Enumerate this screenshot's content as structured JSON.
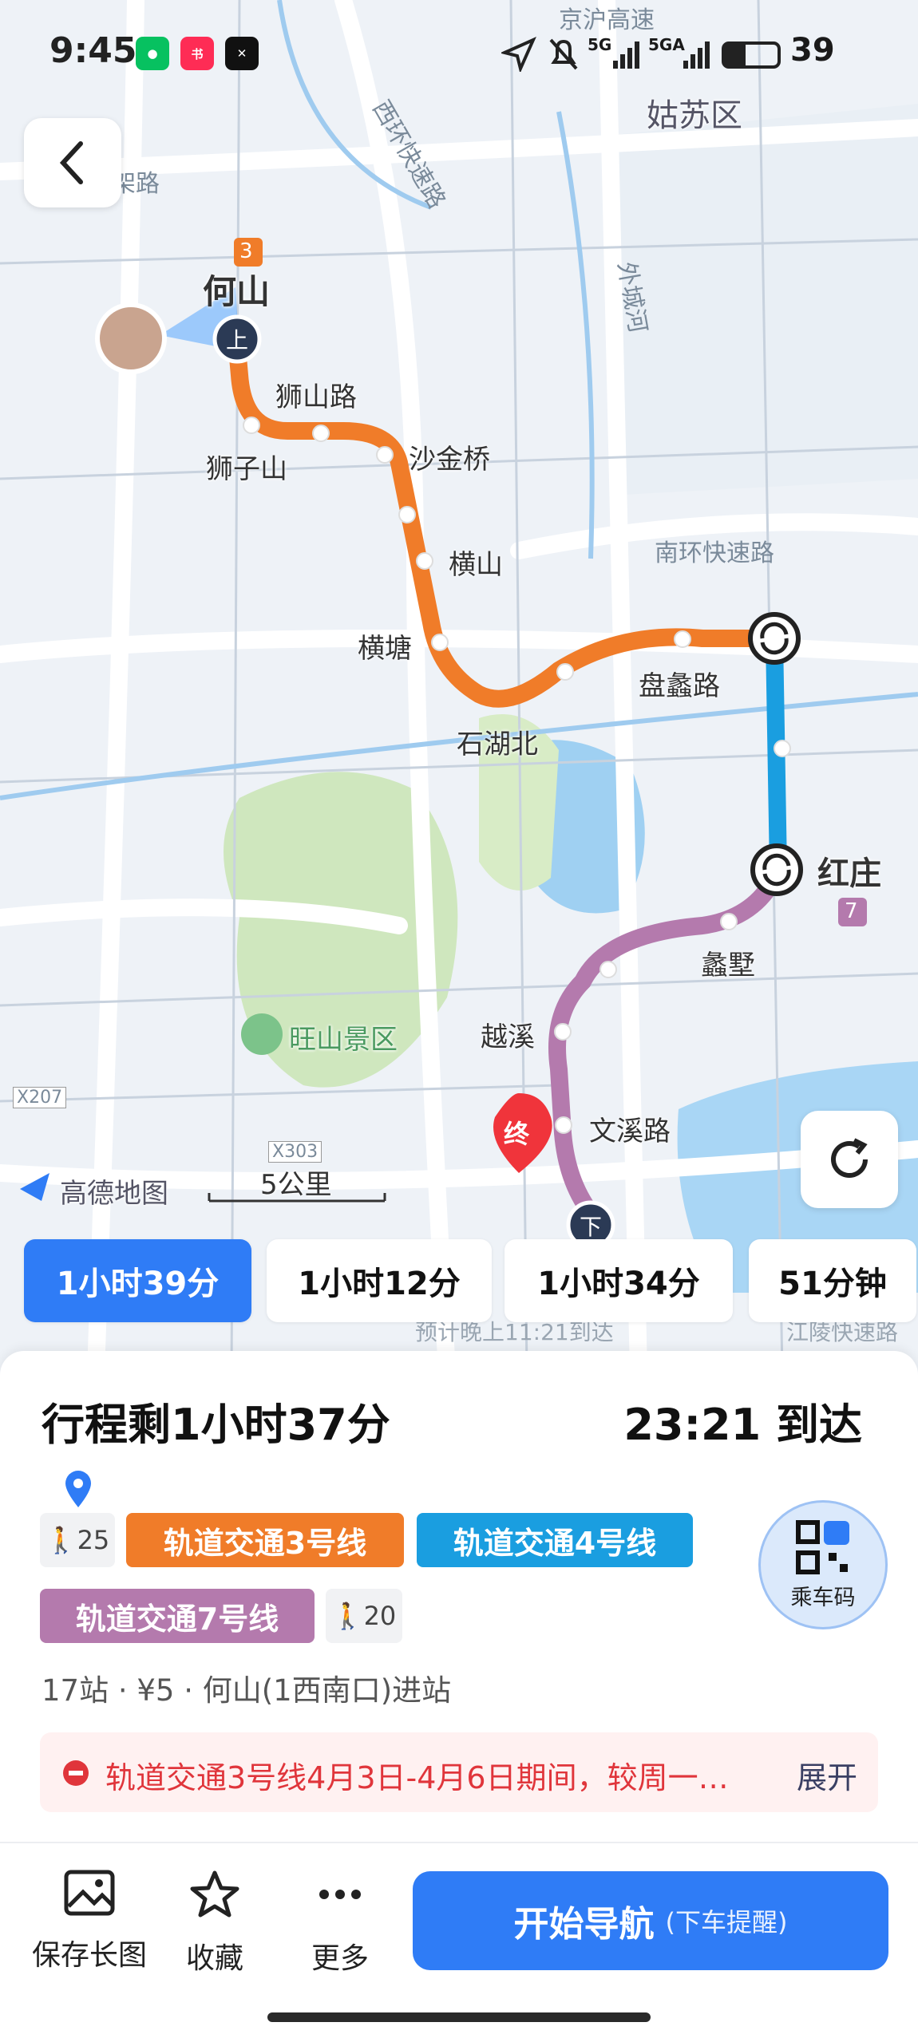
{
  "status_bar": {
    "time": "9:45",
    "network_1": "5G",
    "network_2": "5GA",
    "battery": "39"
  },
  "map": {
    "district_label": "姑苏区",
    "road_labels": [
      "京沪高速",
      "西环快速路",
      "外城河",
      "南环快速路",
      "高架路",
      "X207",
      "X303"
    ],
    "scenic_label": "旺山景区",
    "logo": "高德地图",
    "scale": "5公里",
    "start_station": "何山",
    "start_line_badge": "3",
    "start_marker": "上",
    "end_marker": "下",
    "end_badge": "终",
    "transfer_badge": "7",
    "stations": [
      "狮山路",
      "狮子山",
      "沙金桥",
      "横山",
      "横塘",
      "石湖北",
      "盘蠡路",
      "红庄",
      "蠡墅",
      "越溪",
      "文溪路"
    ],
    "arrival_hint": "预计晚上11:21到达",
    "road_hint": "江陵快速路"
  },
  "route_tabs": [
    {
      "label": "1小时39分",
      "active": true
    },
    {
      "label": "1小时12分",
      "active": false
    },
    {
      "label": "1小时34分",
      "active": false
    },
    {
      "label": "51分钟",
      "active": false
    }
  ],
  "sheet": {
    "trip_remaining": "行程剩1小时37分",
    "arrival": "23:21 到达",
    "walk_start": "25",
    "walk_end": "20",
    "segments": [
      {
        "label": "轨道交通3号线",
        "color": "#f07c29"
      },
      {
        "label": "轨道交通4号线",
        "color": "#1a9ee0"
      },
      {
        "label": "轨道交通7号线",
        "color": "#b47aad"
      }
    ],
    "info": "17站 · ¥5 · 何山(1西南口)进站",
    "notice": "轨道交通3号线4月3日-4月6日期间，较周一…",
    "notice_more": "展开",
    "qr_label": "乘车码",
    "actions": [
      "保存长图",
      "收藏",
      "更多"
    ],
    "nav_main": "开始导航",
    "nav_sub": "(下车提醒)"
  }
}
